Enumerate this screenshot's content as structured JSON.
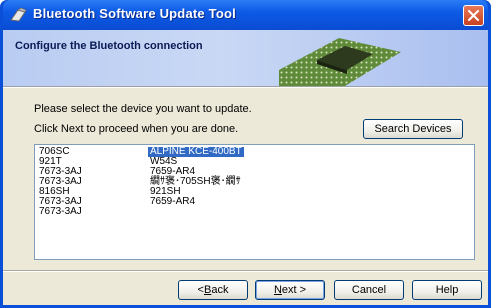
{
  "window": {
    "title": "Bluetooth Software Update Tool",
    "colors": {
      "titlebar": "#0a4fd8",
      "close": "#c8411f",
      "selection": "#316ac5"
    }
  },
  "banner": {
    "heading": "Configure the Bluetooth connection",
    "art_icon": "circuit-board-image"
  },
  "instructions": {
    "line1": "Please select the device you want to update.",
    "line2": "Click Next to proceed when you are done."
  },
  "search_button": "Search Devices",
  "device_list": {
    "column1": [
      "706SC",
      "921T",
      "7673-3AJ",
      "7673-3AJ",
      "816SH",
      "7673-3AJ",
      "7673-3AJ"
    ],
    "column2": [
      "ALPINE KCE-400BT",
      "W54S",
      "7659-AR4",
      "繝ｻ褒･705SH褒･繝ｻ",
      "921SH",
      "7659-AR4"
    ],
    "selected": "ALPINE KCE-400BT"
  },
  "footer": {
    "back_prefix": "< ",
    "back_accel": "B",
    "back_rest": "ack",
    "next_accel": "N",
    "next_rest": "ext >",
    "cancel": "Cancel",
    "help": "Help"
  }
}
